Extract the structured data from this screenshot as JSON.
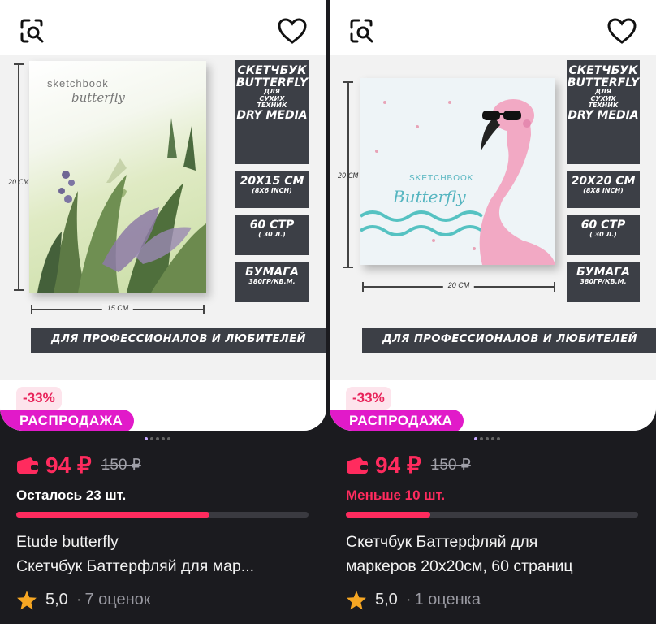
{
  "cards": [
    {
      "image": {
        "book_line1": "sketchbook",
        "book_line2": "butterfly",
        "height_label": "20 СМ",
        "width_label": "15 СМ",
        "info1": [
          "СКЕТЧБУК",
          "BUTTERFLY",
          "ДЛЯ",
          "СУХИХ",
          "ТЕХНИК",
          "DRY MEDIA"
        ],
        "info2": [
          "20X15 СМ",
          "(8X6 INCH)"
        ],
        "info3": [
          "60 СТР",
          "( 30 Л.)"
        ],
        "info4": [
          "БУМАГА",
          "380ГР/КВ.М."
        ],
        "banner": "ДЛЯ ПРОФЕССИОНАЛОВ И ЛЮБИТЕЛЕЙ"
      },
      "discount": "-33%",
      "sale": "РАСПРОДАЖА",
      "price": "94 ₽",
      "old_price": "150 ₽",
      "stock": "Осталось 23 шт.",
      "stock_level": 0.66,
      "title_line1": "Etude butterfly",
      "title_line2": "Скетчбук Баттерфляй для мар...",
      "rating": "5,0",
      "rating_sep": "·",
      "reviews": "7 оценок"
    },
    {
      "image": {
        "book_line1": "SKETCHBOOK",
        "book_line2": "Butterfly",
        "height_label": "20 СМ",
        "width_label": "20 СМ",
        "info1": [
          "СКЕТЧБУК",
          "BUTTERFLY",
          "ДЛЯ",
          "СУХИХ",
          "ТЕХНИК",
          "DRY MEDIA"
        ],
        "info2": [
          "20X20 СМ",
          "(8X8 INCH)"
        ],
        "info3": [
          "60 СТР",
          "( 30 Л.)"
        ],
        "info4": [
          "БУМАГА",
          "380ГР/КВ.М."
        ],
        "banner": "ДЛЯ ПРОФЕССИОНАЛОВ И ЛЮБИТЕЛЕЙ"
      },
      "discount": "-33%",
      "sale": "РАСПРОДАЖА",
      "price": "94 ₽",
      "old_price": "150 ₽",
      "stock": "Меньше 10 шт.",
      "stock_level": 0.29,
      "title_line1": "Скетчбук Баттерфляй для",
      "title_line2": "маркеров 20х20см, 60 страниц",
      "rating": "5,0",
      "rating_sep": "·",
      "reviews": "1 оценка"
    }
  ],
  "icons": {
    "search": "image-search-icon",
    "favorite": "heart-outline-icon",
    "wallet": "wallet-icon",
    "star": "star-icon"
  },
  "colors": {
    "background": "#1b1b1f",
    "price": "#ff2b5e",
    "sale_badge": "#e11ac9",
    "discount_badge_bg": "#fde4ec",
    "star": "#f5a623"
  },
  "carousel": {
    "pages": 5,
    "active": 0
  }
}
